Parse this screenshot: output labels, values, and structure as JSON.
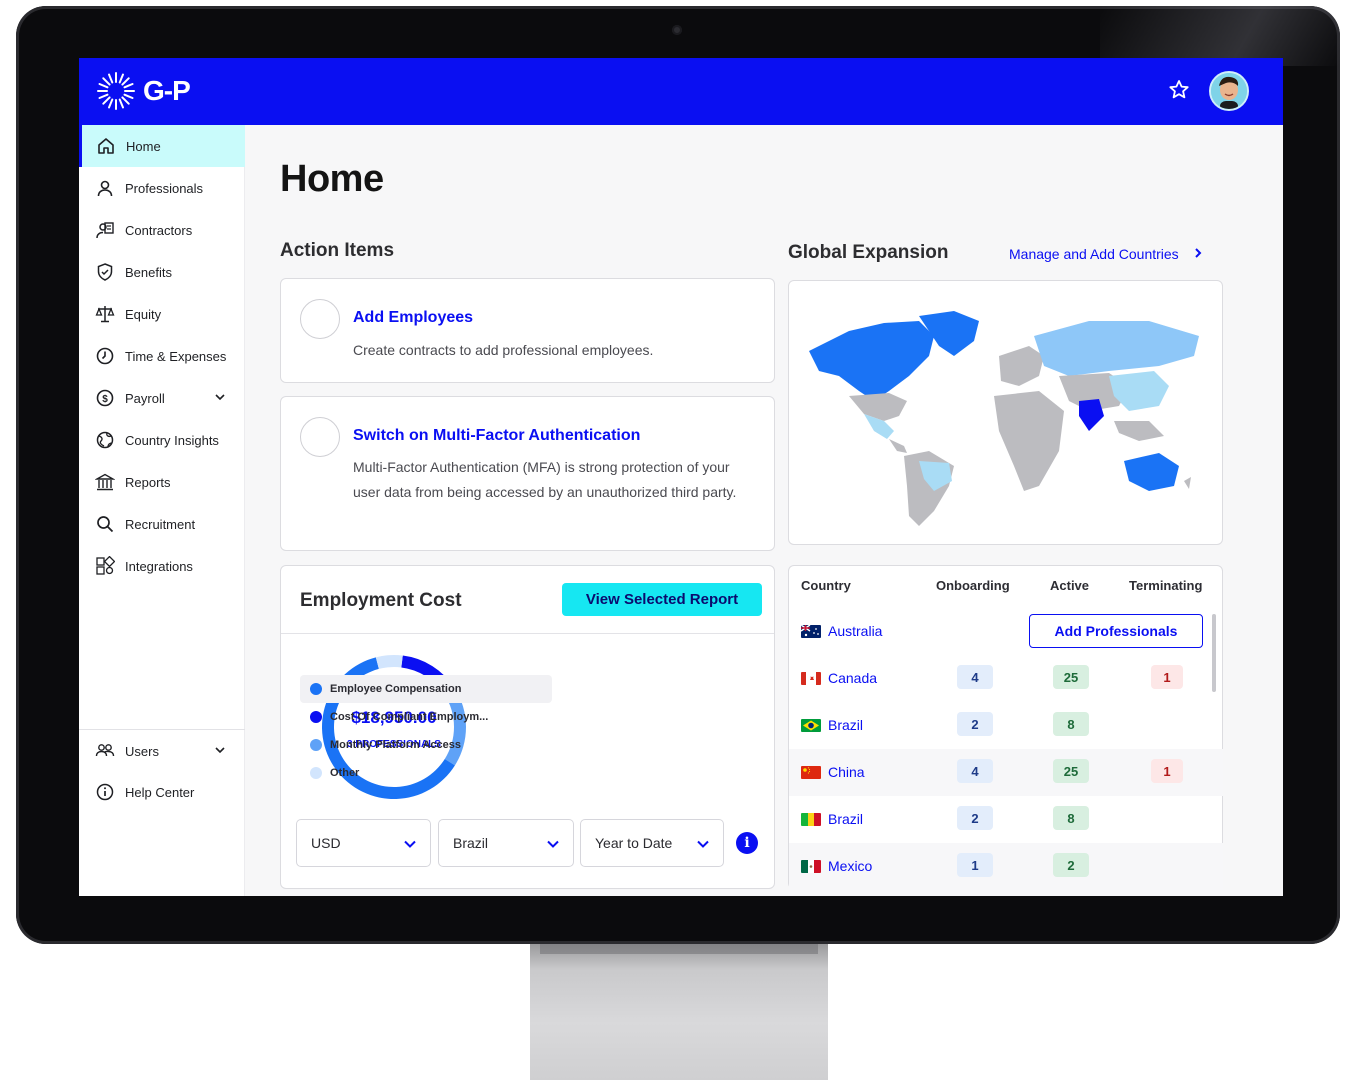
{
  "brand": {
    "logo_text": "G-P",
    "primary": "#0a0ff2",
    "accent": "#16e7f2"
  },
  "topbar": {
    "favorite_icon": "star-icon",
    "avatar_icon": "user-avatar"
  },
  "sidebar": {
    "items": [
      {
        "label": "Home",
        "icon": "home-icon"
      },
      {
        "label": "Professionals",
        "icon": "person-icon"
      },
      {
        "label": "Contractors",
        "icon": "contractor-icon"
      },
      {
        "label": "Benefits",
        "icon": "shield-check-icon"
      },
      {
        "label": "Equity",
        "icon": "scale-icon"
      },
      {
        "label": "Time & Expenses",
        "icon": "clock-icon"
      },
      {
        "label": "Payroll",
        "icon": "dollar-icon"
      },
      {
        "label": "Country Insights",
        "icon": "globe-icon"
      },
      {
        "label": "Reports",
        "icon": "bank-icon"
      },
      {
        "label": "Recruitment",
        "icon": "search-icon"
      },
      {
        "label": "Integrations",
        "icon": "integrations-icon"
      }
    ],
    "bottom": [
      {
        "label": "Users",
        "icon": "users-icon"
      },
      {
        "label": "Help Center",
        "icon": "info-circle-icon"
      }
    ]
  },
  "main": {
    "title": "Home",
    "action_items": {
      "title": "Action Items",
      "items": [
        {
          "title": "Add Employees",
          "desc": "Create contracts to add professional employees."
        },
        {
          "title": "Switch on Multi-Factor Authentication",
          "desc": "Multi-Factor Authentication (MFA) is strong protection of your user data from being accessed by an unauthorized third party."
        }
      ]
    },
    "global_expansion": {
      "title": "Global Expansion",
      "link": "Manage and Add Countries"
    },
    "employment_cost": {
      "title": "Employment Cost",
      "button": "View Selected Report",
      "total": "$18,950.00",
      "subtitle": "3 PROFESSIONALS",
      "legend": [
        {
          "label": "Employee Compensation",
          "color": "#1a73f5",
          "share": 0.62
        },
        {
          "label": "Cost Of Compliant Employm...",
          "color": "#0a0ff2",
          "share": 0.14
        },
        {
          "label": "Monthly Platform Access",
          "color": "#5fa2f7",
          "share": 0.18
        },
        {
          "label": "Other",
          "color": "#d2e5fd",
          "share": 0.06
        }
      ],
      "filters": {
        "currency": "USD",
        "country": "Brazil",
        "period": "Year to Date"
      }
    },
    "countries_table": {
      "headers": [
        "Country",
        "Onboarding",
        "Active",
        "Terminating"
      ],
      "add_button": "Add Professionals",
      "rows": [
        {
          "country": "Australia",
          "flag": "au",
          "onboarding": "",
          "active": "",
          "terminating": ""
        },
        {
          "country": "Canada",
          "flag": "ca",
          "onboarding": "4",
          "active": "25",
          "terminating": "1"
        },
        {
          "country": "Brazil",
          "flag": "br",
          "onboarding": "2",
          "active": "8",
          "terminating": ""
        },
        {
          "country": "China",
          "flag": "cn",
          "onboarding": "4",
          "active": "25",
          "terminating": "1"
        },
        {
          "country": "Brazil",
          "flag": "ml",
          "onboarding": "2",
          "active": "8",
          "terminating": ""
        },
        {
          "country": "Mexico",
          "flag": "mx",
          "onboarding": "1",
          "active": "2",
          "terminating": ""
        }
      ]
    }
  }
}
